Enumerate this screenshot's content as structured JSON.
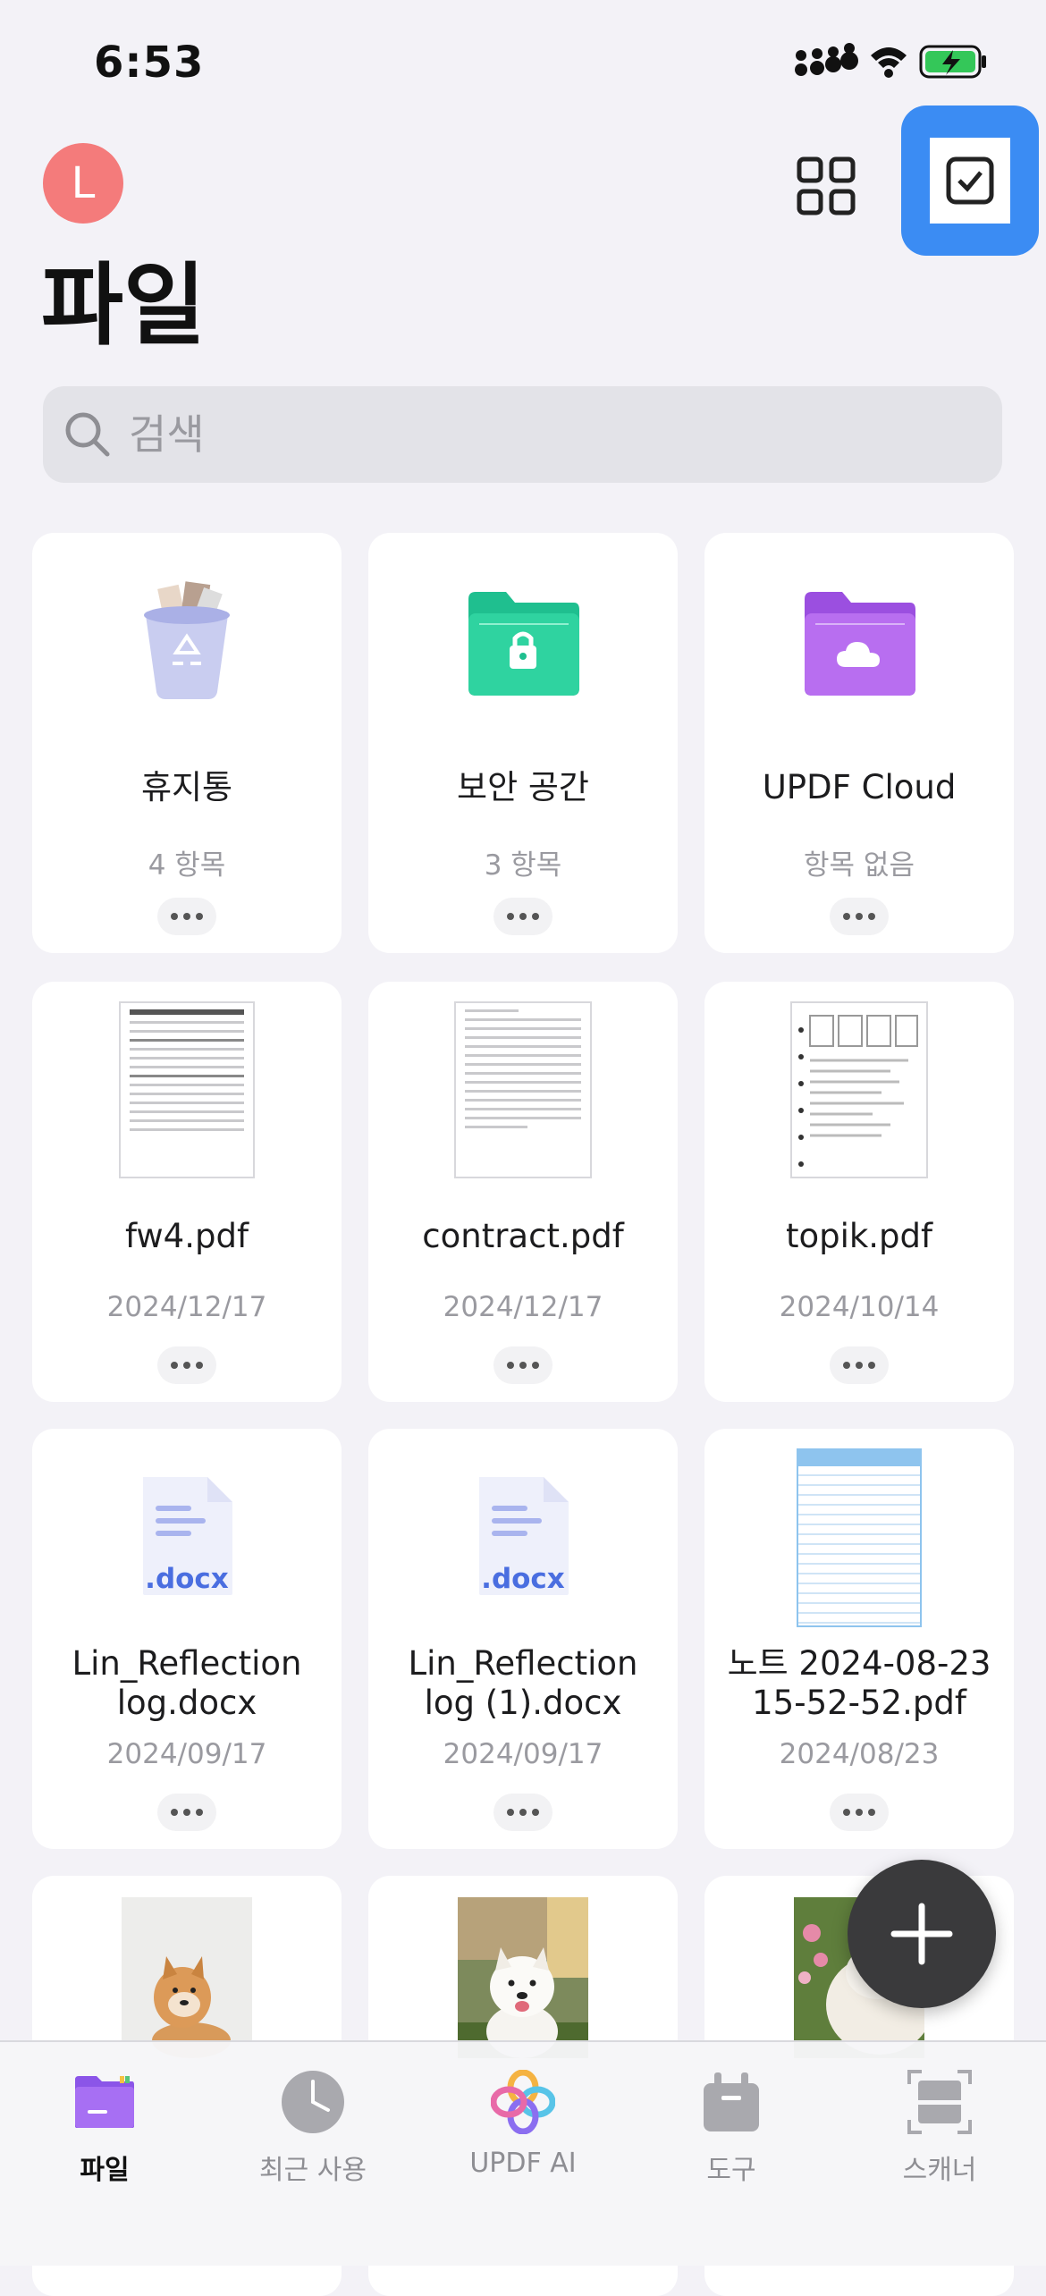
{
  "status_bar": {
    "time": "6:53"
  },
  "header": {
    "avatar_letter": "L",
    "title": "파일"
  },
  "search": {
    "placeholder": "검색"
  },
  "folders": [
    {
      "name": "휴지통",
      "meta": "4 항목",
      "icon": "trash-icon"
    },
    {
      "name": "보안 공간",
      "meta": "3 항목",
      "icon": "lock-folder-icon"
    },
    {
      "name": "UPDF Cloud",
      "meta": "항목 없음",
      "icon": "cloud-folder-icon"
    }
  ],
  "files": [
    {
      "name": "fw4.pdf",
      "date": "2024/12/17"
    },
    {
      "name": "contract.pdf",
      "date": "2024/12/17"
    },
    {
      "name": "topik.pdf",
      "date": "2024/10/14"
    },
    {
      "name_line1": "Lin_Reflection",
      "name_line2": "log.docx",
      "date": "2024/09/17",
      "badge": ".docx"
    },
    {
      "name_line1": "Lin_Reflection",
      "name_line2": "log (1).docx",
      "date": "2024/09/17",
      "badge": ".docx"
    },
    {
      "name_line1": "노트 2024-08-23",
      "name_line2": "15-52-52.pdf",
      "date": "2024/08/23"
    }
  ],
  "tabs": [
    {
      "label": "파일",
      "icon": "folder-icon",
      "active": true
    },
    {
      "label": "최근 사용",
      "icon": "clock-icon"
    },
    {
      "label": "UPDF AI",
      "icon": "ai-icon"
    },
    {
      "label": "도구",
      "icon": "toolbox-icon"
    },
    {
      "label": "스캐너",
      "icon": "scanner-icon"
    }
  ],
  "colors": {
    "accent": "#3b8cf3",
    "avatar": "#f47b7b",
    "fab": "#3a3a3c",
    "background": "#f3f2f7"
  }
}
